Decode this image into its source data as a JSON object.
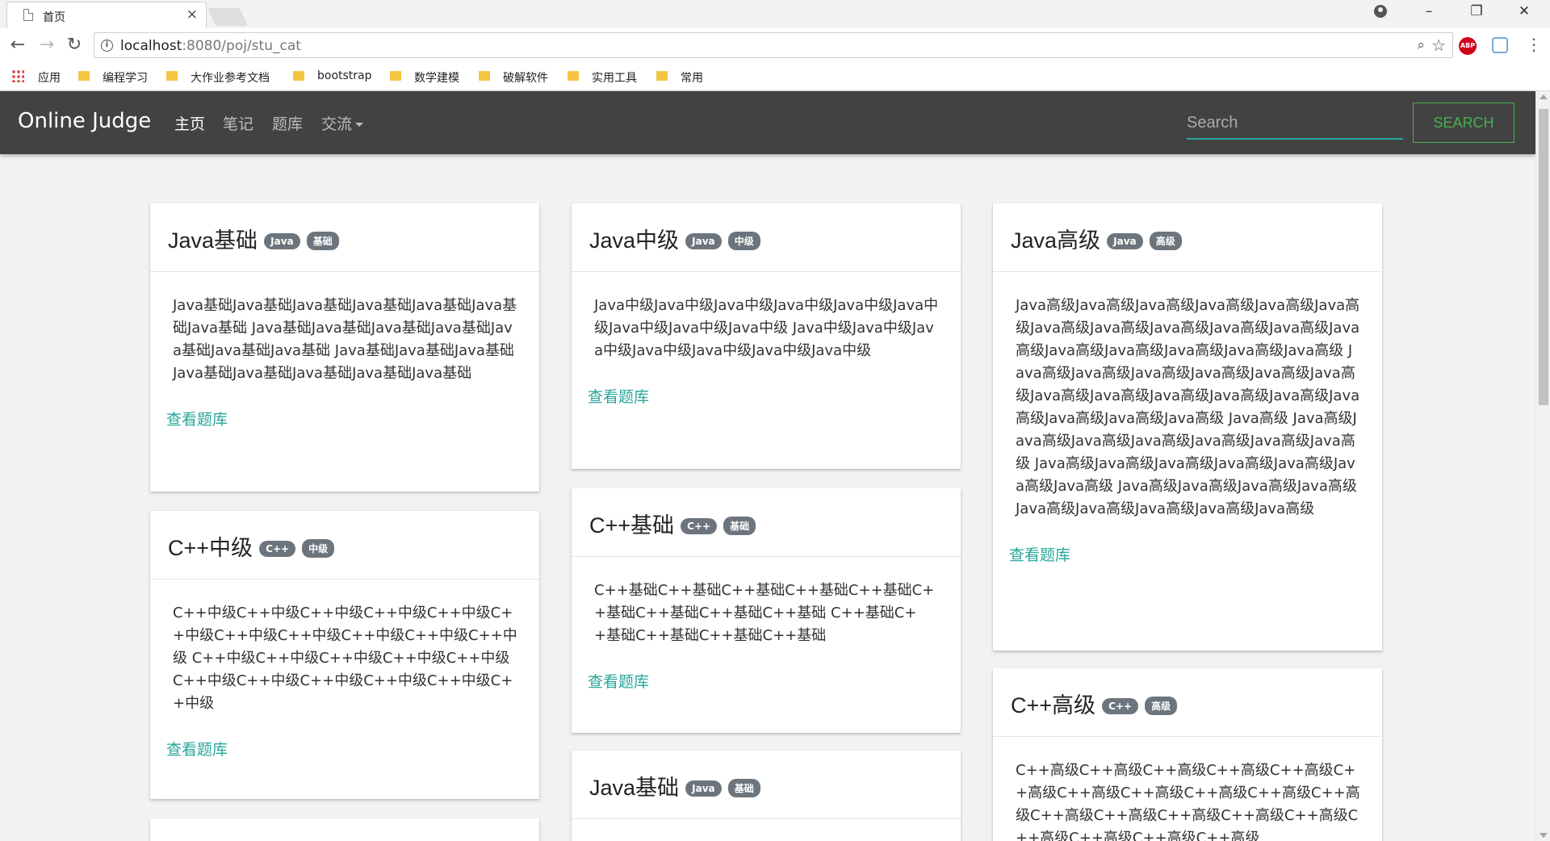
{
  "browser": {
    "tab_title": "首页",
    "tab_close": "×",
    "url_host": "localhost",
    "url_path": ":8080/poj/stu_cat",
    "window_controls": [
      "minimize-icon",
      "restore-icon",
      "close-icon"
    ],
    "bookmarks": [
      "应用",
      "编程学习",
      "大作业参考文档",
      "bootstrap",
      "数学建模",
      "破解软件",
      "实用工具",
      "常用"
    ],
    "abp_label": "ABP"
  },
  "navbar": {
    "brand": "Online Judge",
    "links": [
      "主页",
      "笔记",
      "题库",
      "交流"
    ],
    "search_placeholder": "Search",
    "search_button": "SEARCH",
    "colors": {
      "background": "#424242",
      "accent": "#26a69a",
      "search_button": "#4caf50"
    }
  },
  "cards": [
    {
      "title": "Java基础",
      "badges": [
        "Java",
        "基础"
      ],
      "body": "Java基础Java基础Java基础Java基础Java基础Java基础Java基础 Java基础Java基础Java基础Java基础Java基础Java基础Java基础 Java基础Java基础Java基础Java基础Java基础Java基础Java基础Java基础",
      "link": "查看题库"
    },
    {
      "title": "C++中级",
      "badges": [
        "C++",
        "中级"
      ],
      "body": "C++中级C++中级C++中级C++中级C++中级C++中级C++中级C++中级C++中级C++中级C++中级 C++中级C++中级C++中级C++中级C++中级C++中级C++中级C++中级C++中级C++中级C++中级",
      "link": "查看题库"
    },
    {
      "title": "Java中级",
      "badges": [
        "Java",
        "中级"
      ],
      "body": "Java中级Java中级Java中级Java中级Java中级Java中级Java中级Java中级Java中级 Java中级Java中级Java中级Java中级Java中级Java中级Java中级",
      "link": "查看题库"
    },
    {
      "title": "C++基础",
      "badges": [
        "C++",
        "基础"
      ],
      "body": "C++基础C++基础C++基础C++基础C++基础C++基础C++基础C++基础C++基础 C++基础C++基础C++基础C++基础C++基础",
      "link": "查看题库"
    },
    {
      "title": "Java基础",
      "badges": [
        "Java",
        "基础"
      ],
      "body": "",
      "link": ""
    },
    {
      "title": "Java高级",
      "badges": [
        "Java",
        "高级"
      ],
      "body": "Java高级Java高级Java高级Java高级Java高级Java高级Java高级Java高级Java高级Java高级Java高级Java高级Java高级Java高级Java高级Java高级Java高级 Java高级Java高级Java高级Java高级Java高级Java高级Java高级Java高级Java高级Java高级Java高级Java高级Java高级Java高级Java高级 Java高级 Java高级Java高级Java高级Java高级Java高级Java高级Java高级 Java高级Java高级Java高级Java高级Java高级Java高级Java高级 Java高级Java高级Java高级Java高级Java高级Java高级Java高级Java高级Java高级",
      "link": "查看题库"
    },
    {
      "title": "C++高级",
      "badges": [
        "C++",
        "高级"
      ],
      "body": "C++高级C++高级C++高级C++高级C++高级C++高级C++高级C++高级C++高级C++高级C++高级C++高级C++高级C++高级C++高级C++高级C++高级C++高级C++高级C++高级",
      "link": ""
    }
  ]
}
